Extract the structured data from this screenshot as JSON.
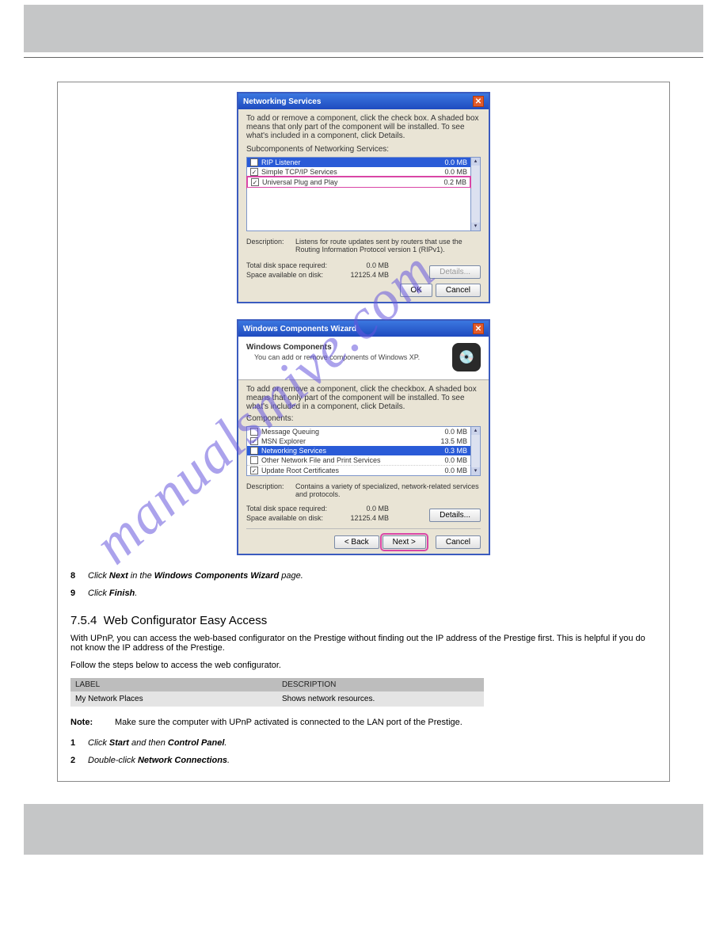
{
  "header": {
    "title": ""
  },
  "dialog1": {
    "title": "Networking Services",
    "topText": "To add or remove a component, click the check box. A shaded box means that only part of the component will be installed. To see what's included in a component, click Details.",
    "listLabel": "Subcomponents of Networking Services:",
    "items": [
      {
        "label": "RIP Listener",
        "size": "0.0 MB",
        "checked": true,
        "selected": true
      },
      {
        "label": "Simple TCP/IP Services",
        "size": "0.0 MB",
        "checked": true,
        "selected": false
      },
      {
        "label": "Universal Plug and Play",
        "size": "0.2 MB",
        "checked": true,
        "selected": false,
        "highlight": true
      }
    ],
    "descLabel": "Description:",
    "descText": "Listens for route updates sent by routers that use the Routing Information Protocol version 1 (RIPv1).",
    "diskReqLabel": "Total disk space required:",
    "diskReqVal": "0.0 MB",
    "diskAvailLabel": "Space available on disk:",
    "diskAvailVal": "12125.4 MB",
    "detailsBtn": "Details...",
    "okBtn": "OK",
    "cancelBtn": "Cancel"
  },
  "dialog2": {
    "title": "Windows Components Wizard",
    "heading": "Windows Components",
    "subheading": "You can add or remove components of Windows XP.",
    "topText": "To add or remove a component, click the checkbox. A shaded box means that only part of the component will be installed. To see what's included in a component, click Details.",
    "listLabel": "Components:",
    "items": [
      {
        "label": "Message Queuing",
        "size": "0.0 MB",
        "checked": false,
        "selected": false
      },
      {
        "label": "MSN Explorer",
        "size": "13.5 MB",
        "checked": true,
        "selected": false
      },
      {
        "label": "Networking Services",
        "size": "0.3 MB",
        "checked": true,
        "selected": true
      },
      {
        "label": "Other Network File and Print Services",
        "size": "0.0 MB",
        "checked": false,
        "selected": false
      },
      {
        "label": "Update Root Certificates",
        "size": "0.0 MB",
        "checked": true,
        "selected": false
      }
    ],
    "descLabel": "Description:",
    "descText": "Contains a variety of specialized, network-related services and protocols.",
    "diskReqLabel": "Total disk space required:",
    "diskReqVal": "0.0 MB",
    "diskAvailLabel": "Space available on disk:",
    "diskAvailVal": "12125.4 MB",
    "detailsBtn": "Details...",
    "backBtn": "< Back",
    "nextBtn": "Next >",
    "cancelBtn": "Cancel"
  },
  "steps": {
    "s8": {
      "num": "8",
      "text_a": "Click ",
      "b1": "Next",
      "text_b": " in the ",
      "b2": "Windows Components Wizard",
      "text_c": " page."
    },
    "s9": {
      "num": "9",
      "text_a": "Click ",
      "b1": "Finish",
      "text_b": "."
    }
  },
  "section": {
    "num": "7.5.4",
    "title": "Web Configurator Easy Access",
    "intro": "With UPnP, you can access the web-based configurator on the Prestige without finding out the IP address of the Prestige first. This is helpful if you do not know the IP address of the Prestige.",
    "follow": "Follow the steps below to access the web configurator."
  },
  "table": {
    "headerL": "LABEL",
    "headerR": "DESCRIPTION",
    "cellL": "My Network Places",
    "cellR": "Shows network resources."
  },
  "note": {
    "label": "Note:",
    "text": "Make sure the computer with UPnP activated is connected to the LAN port of the Prestige."
  },
  "steps2": {
    "s1": {
      "num": "1",
      "text_a": "Click ",
      "b1": "Start",
      "text_b": " and then ",
      "b2": "Control Panel",
      "text_c": "."
    },
    "s2": {
      "num": "2",
      "text_a": "Double-click ",
      "b1": "Network Connections",
      "text_b": "."
    }
  },
  "footer": {
    "pagenum": ""
  },
  "watermark": "manualsmive.com"
}
